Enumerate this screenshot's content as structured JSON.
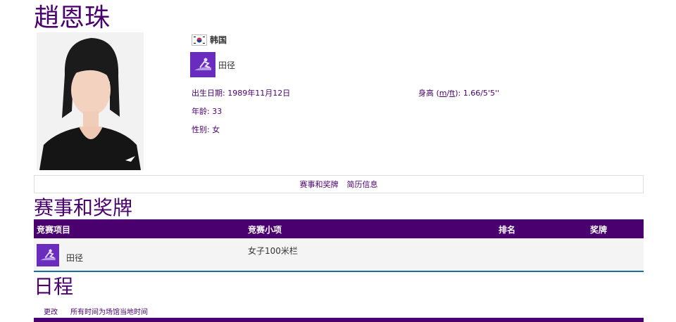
{
  "athlete": {
    "name": "趙恩珠",
    "country": "韩国",
    "sport": "田径",
    "birth_label": "出生日期:",
    "birth_value": "1989年11月12日",
    "height_label": "身高",
    "height_unit_m": "m",
    "height_unit_ft": "ft",
    "height_value": "1.66/5'5''",
    "age_label": "年龄:",
    "age_value": "33",
    "gender_label": "性别:",
    "gender_value": "女"
  },
  "nav": {
    "items": [
      "赛事和奖牌",
      "简历信息"
    ]
  },
  "events_section": {
    "title": "赛事和奖牌",
    "columns": [
      "竞赛项目",
      "竞赛小项",
      "排名",
      "奖牌"
    ],
    "rows": [
      {
        "sport": "田径",
        "event": "女子100米栏",
        "rank": "",
        "medal": ""
      }
    ]
  },
  "schedule": {
    "title": "日程",
    "change_label": "更改",
    "note": "所有时间为场馆当地时间"
  },
  "colors": {
    "brand": "#4a006e",
    "sport_icon_bg": "#6a2bbf",
    "row_divider": "#1a6fa0"
  },
  "icons": {
    "flag": "korea-flag-icon",
    "sport": "athletics-icon"
  }
}
